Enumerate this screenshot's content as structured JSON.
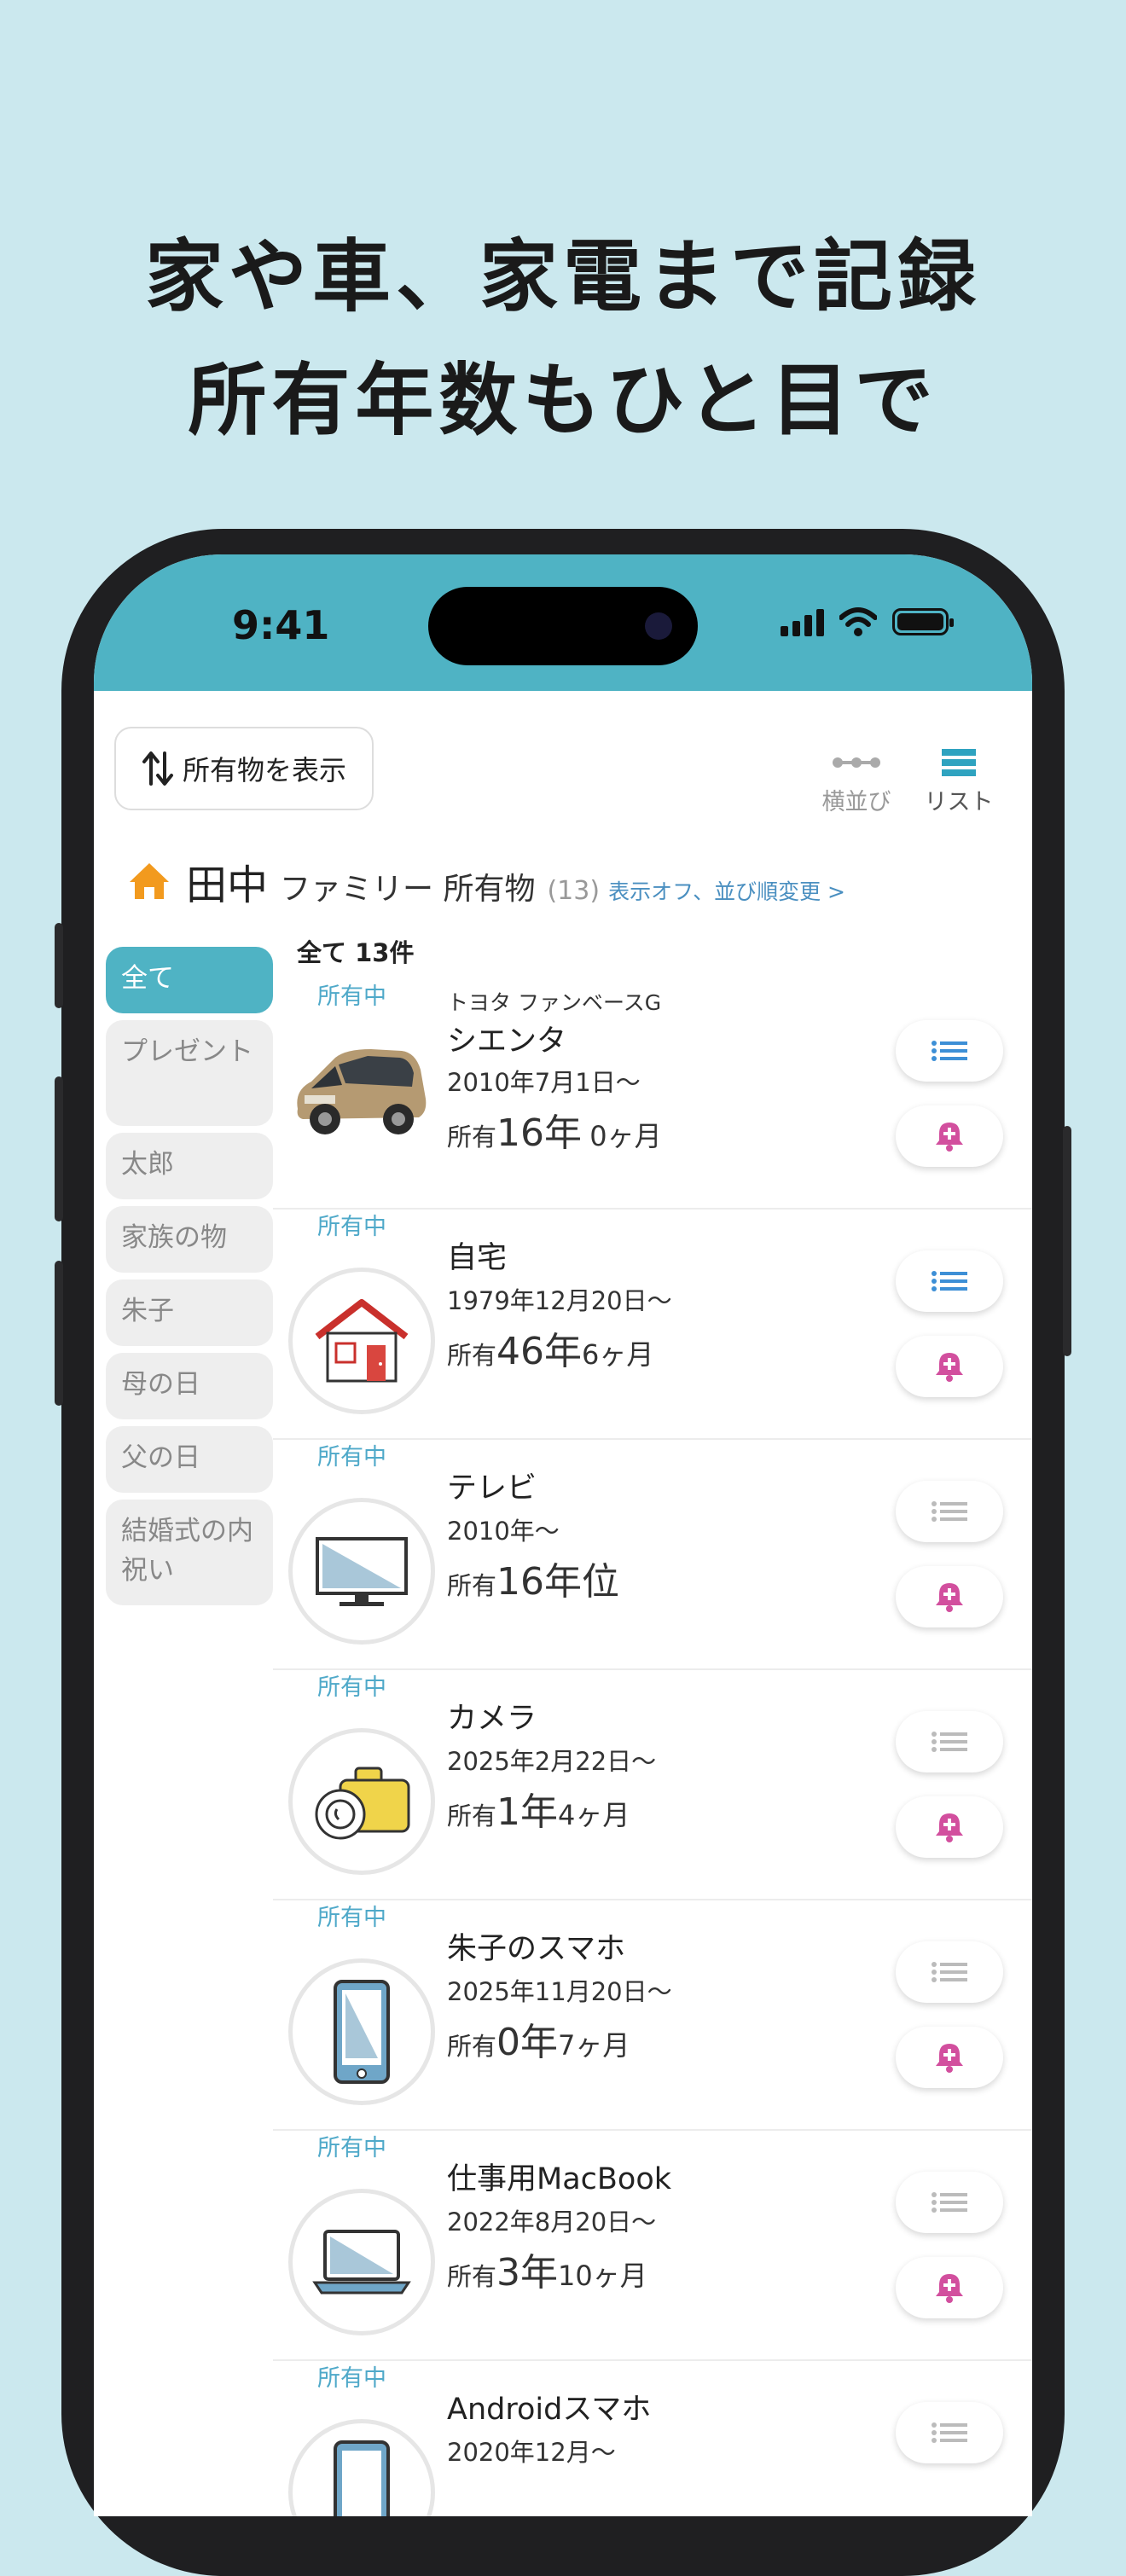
{
  "headline": {
    "line1": "家や車、家電まで記録",
    "line2": "所有年数もひと目で"
  },
  "status_bar": {
    "time": "9:41"
  },
  "toolbar": {
    "toggle_label": "所有物を表示",
    "side_label": "横並び",
    "list_label": "リスト"
  },
  "family": {
    "name": "田中",
    "title": "ファミリー 所有物",
    "count": "(13)",
    "link": "表示オフ、並び順変更 >"
  },
  "categories": [
    {
      "label": "全て"
    },
    {
      "label": "プレゼント"
    },
    {
      "label": "太郎"
    },
    {
      "label": "家族の物"
    },
    {
      "label": "朱子"
    },
    {
      "label": "母の日"
    },
    {
      "label": "父の日"
    },
    {
      "label": "結婚式の内祝い"
    }
  ],
  "all_count": "全て 13件",
  "colors": {
    "accent": "#4fb3c4",
    "status_text": "#4fa9c9",
    "bell": "#d24f9e",
    "list_icon_active": "#3d8fd6",
    "list_icon_inactive": "#bbbbbb"
  },
  "items": [
    {
      "status": "所有中",
      "maker": "トヨタ ファンベースG",
      "name": "シエンタ",
      "date": "2010年7月1日〜",
      "own_prefix": "所有",
      "own_years": "16年",
      "own_months": "0ヶ月",
      "icon": "car-icon"
    },
    {
      "status": "所有中",
      "maker": "",
      "name": "自宅",
      "date": "1979年12月20日〜",
      "own_prefix": "所有",
      "own_years": "46年",
      "own_months": "6ヶ月",
      "icon": "house-icon"
    },
    {
      "status": "所有中",
      "maker": "",
      "name": "テレビ",
      "date": "2010年〜",
      "own_prefix": "所有",
      "own_years": "16年位",
      "own_months": "",
      "icon": "tv-icon"
    },
    {
      "status": "所有中",
      "maker": "",
      "name": "カメラ",
      "date": "2025年2月22日〜",
      "own_prefix": "所有",
      "own_years": "1年",
      "own_months": "4ヶ月",
      "icon": "camera-icon"
    },
    {
      "status": "所有中",
      "maker": "",
      "name": "朱子のスマホ",
      "date": "2025年11月20日〜",
      "own_prefix": "所有",
      "own_years": "0年",
      "own_months": "7ヶ月",
      "icon": "smartphone-icon"
    },
    {
      "status": "所有中",
      "maker": "",
      "name": "仕事用MacBook",
      "date": "2022年8月20日〜",
      "own_prefix": "所有",
      "own_years": "3年",
      "own_months": "10ヶ月",
      "icon": "laptop-icon"
    },
    {
      "status": "所有中",
      "maker": "",
      "name": "Androidスマホ",
      "date": "2020年12月〜",
      "own_prefix": "",
      "own_years": "",
      "own_months": "",
      "icon": "smartphone-icon"
    }
  ]
}
